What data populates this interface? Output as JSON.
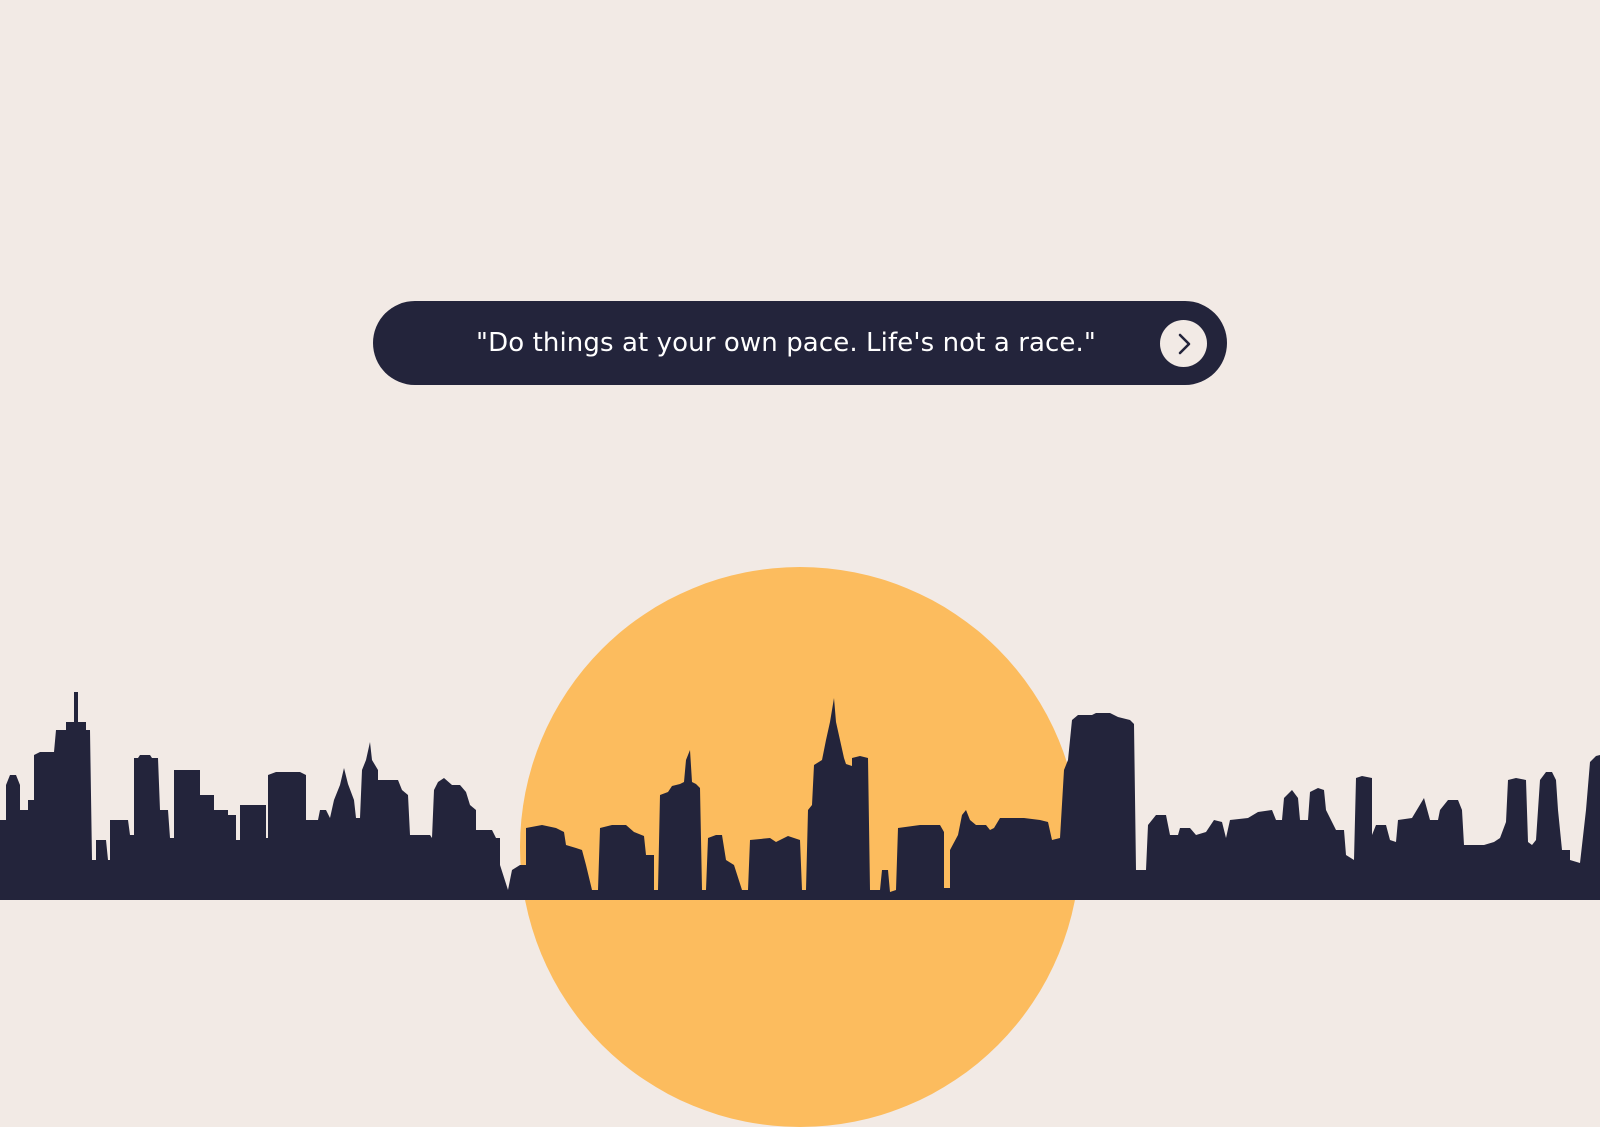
{
  "quote": {
    "text": "\"Do things at your own pace. Life's not a race.\""
  },
  "next_button": {
    "icon": "chevron-right-icon"
  },
  "colors": {
    "background": "#f2eae5",
    "pill": "#23243b",
    "text": "#ffffff",
    "sun": "#fcbc5e",
    "skyline": "#23243b"
  }
}
